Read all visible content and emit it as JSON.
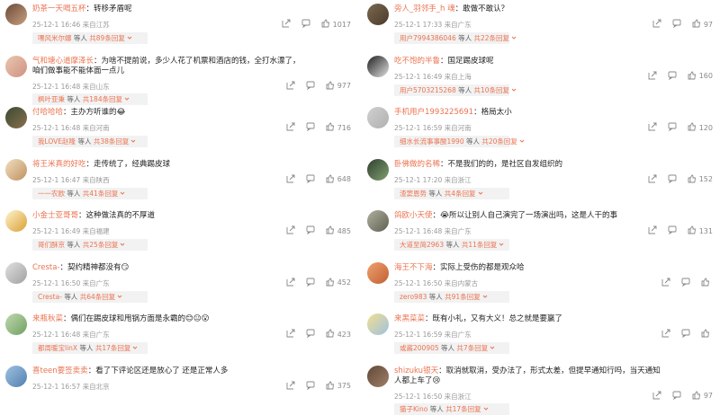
{
  "left": [
    {
      "name": "奶茶一天喝五杯",
      "text": "：转移矛盾呢",
      "date": "25-12-1 16:46",
      "loc": "来自江苏",
      "likes": "1017",
      "reply_user": "嘿风米尔娜",
      "reply_label": "等人",
      "reply_count": "共89条回复",
      "colors": [
        "#6b4a3a",
        "#c8a080"
      ]
    },
    {
      "name": "气和塘心道摩泽长",
      "text": "：为啥不提前说，多少人花了机票和酒店的钱，全打水漂了，咱们做事能不能体面一点儿",
      "date": "25-12-1 16:48",
      "loc": "来自山东",
      "likes": "977",
      "reply_user": "枫叶亚秉",
      "reply_label": "等人",
      "reply_count": "共184条回复",
      "colors": [
        "#e8c8b0",
        "#d09080"
      ],
      "two": true
    },
    {
      "name": "付哈哈哈",
      "text": "：主办方听谁的😂",
      "date": "25-12-1 16:48",
      "loc": "来自河南",
      "likes": "716",
      "reply_user": "我LOVE赵隆",
      "reply_label": "等人",
      "reply_count": "共38条回复",
      "colors": [
        "#3a4a30",
        "#8a7050"
      ]
    },
    {
      "name": "将王米真的好吃",
      "text": "：走传统了，经典踢皮球",
      "date": "25-12-1 16:47",
      "loc": "来自陕西",
      "likes": "648",
      "reply_user": "一一农欧",
      "reply_label": "等人",
      "reply_count": "共41条回复",
      "colors": [
        "#f0e0c0",
        "#c09060"
      ]
    },
    {
      "name": "小金士亚哥哥",
      "text": "：这种做法真的不厚道",
      "date": "25-12-1 16:49",
      "loc": "来自福建",
      "likes": "485",
      "reply_user": "哥们酥京",
      "reply_label": "等人",
      "reply_count": "共25条回复",
      "colors": [
        "#fff4d0",
        "#d8a030"
      ]
    },
    {
      "name": "Cresta-",
      "text": "：契约精神都没有😏",
      "date": "25-12-1 16:50",
      "loc": "来自广东",
      "likes": "452",
      "reply_user": "Cresta-",
      "reply_label": "等人",
      "reply_count": "共64条回复",
      "colors": [
        "#e0e0e0",
        "#a0a0a0"
      ]
    },
    {
      "name": "来瓶秋菜",
      "text": "：偶们在踢皮球和甩锅方面是永霸的😊😐😮",
      "date": "25-12-1 16:48",
      "loc": "来自广东",
      "likes": "423",
      "reply_user": "都周暖宝linX",
      "reply_label": "等人",
      "reply_count": "共17条回复",
      "colors": [
        "#c0d8b0",
        "#70a060"
      ]
    },
    {
      "name": "喜teen要签卖卖",
      "text": "：看了下评论区还是放心了 还是正常人多",
      "date": "25-12-1 16:57",
      "loc": "来自北京",
      "likes": "375",
      "reply_user": "",
      "reply_label": "",
      "reply_count": "",
      "colors": [
        "#a0c0e0",
        "#5080b0"
      ]
    }
  ],
  "right": [
    {
      "name": "旁人_羽邻手_h 魂",
      "text": "：敢做不敢认？",
      "date": "25-12-1 17:33",
      "loc": "来自广东",
      "likes": "97",
      "reply_user": "用户7994386046",
      "reply_label": "等人",
      "reply_count": "共22条回复",
      "colors": [
        "#7a6a50",
        "#4a3a2a"
      ]
    },
    {
      "name": "吃不饱的半鲁",
      "text": "：国足踢皮球呢",
      "date": "25-12-1 16:49",
      "loc": "来自上海",
      "likes": "160",
      "reply_user": "用户5703215268",
      "reply_label": "等人",
      "reply_count": "共10条回复",
      "colors": [
        "#202020",
        "#e0e0e0"
      ]
    },
    {
      "name": "手机用户1993225691",
      "text": "：格局太小",
      "date": "25-12-1 16:59",
      "loc": "来自河南",
      "likes": "120",
      "reply_user": "细水长流事事酸1990",
      "reply_label": "等人",
      "reply_count": "共20条回复",
      "colors": [
        "#d0d0d0",
        "#b0b0b0"
      ]
    },
    {
      "name": "卧佛做的名稀",
      "text": "：不是我们的的，是社区自发组织的",
      "date": "25-12-1 17:20",
      "loc": "来自浙江",
      "likes": "152",
      "reply_user": "渣窦恩势",
      "reply_label": "等人",
      "reply_count": "共4条回复",
      "colors": [
        "#304030",
        "#80a070"
      ]
    },
    {
      "name": "鸽欧小天使",
      "text": "：😭所以让别人自己演完了一场演出吗，这是人干的事",
      "date": "25-12-1 16:48",
      "loc": "来自广东",
      "likes": "131",
      "reply_user": "大道至简2963",
      "reply_label": "等人",
      "reply_count": "共11条回复",
      "colors": [
        "#b0b0a0",
        "#606050"
      ]
    },
    {
      "name": "海王不下海",
      "text": "：实际上受伤的都是观众哈",
      "date": "25-12-1 16:50",
      "loc": "来自内蒙古",
      "likes": "",
      "reply_user": "zero983",
      "reply_label": "等人",
      "reply_count": "共91条回复",
      "colors": [
        "#f0a070",
        "#c06030"
      ]
    },
    {
      "name": "来黑菜菜",
      "text": "：既有小礼，又有大义！总之就是要赢了",
      "date": "25-12-1 16:59",
      "loc": "来自广东",
      "likes": "",
      "reply_user": "或酱200905",
      "reply_label": "等人",
      "reply_count": "共7条回复",
      "colors": [
        "#f0e090",
        "#a0c0e0"
      ]
    },
    {
      "name": "shizuku银天",
      "text": "：取消就取消，受办法了，形式太差，但提早通知行吗，当天通知人都上车了😢",
      "date": "25-12-1 16:50",
      "loc": "来自浙江",
      "likes": "97",
      "reply_user": "猫子Kino",
      "reply_label": "等人",
      "reply_count": "共17条回复",
      "colors": [
        "#604838",
        "#a08068"
      ],
      "two": true
    }
  ],
  "icons": {
    "share": "share-icon",
    "comment": "comment-icon",
    "like": "like-icon",
    "chevron": "chevron-down-icon"
  }
}
